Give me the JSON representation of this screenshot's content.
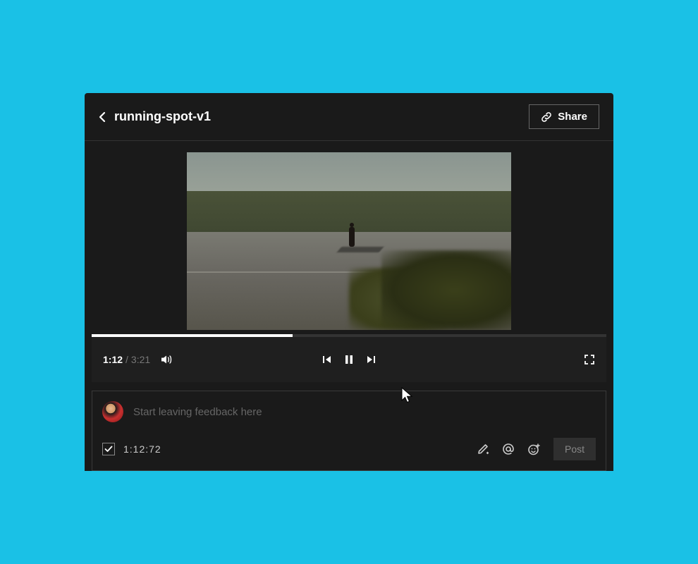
{
  "header": {
    "title": "running-spot-v1",
    "share_label": "Share"
  },
  "player": {
    "time_current": "1:12",
    "time_separator": "/",
    "time_total": "3:21",
    "progress_percent": 39
  },
  "feedback": {
    "placeholder": "Start leaving feedback here",
    "timestamp": "1:12:72",
    "post_label": "Post"
  }
}
